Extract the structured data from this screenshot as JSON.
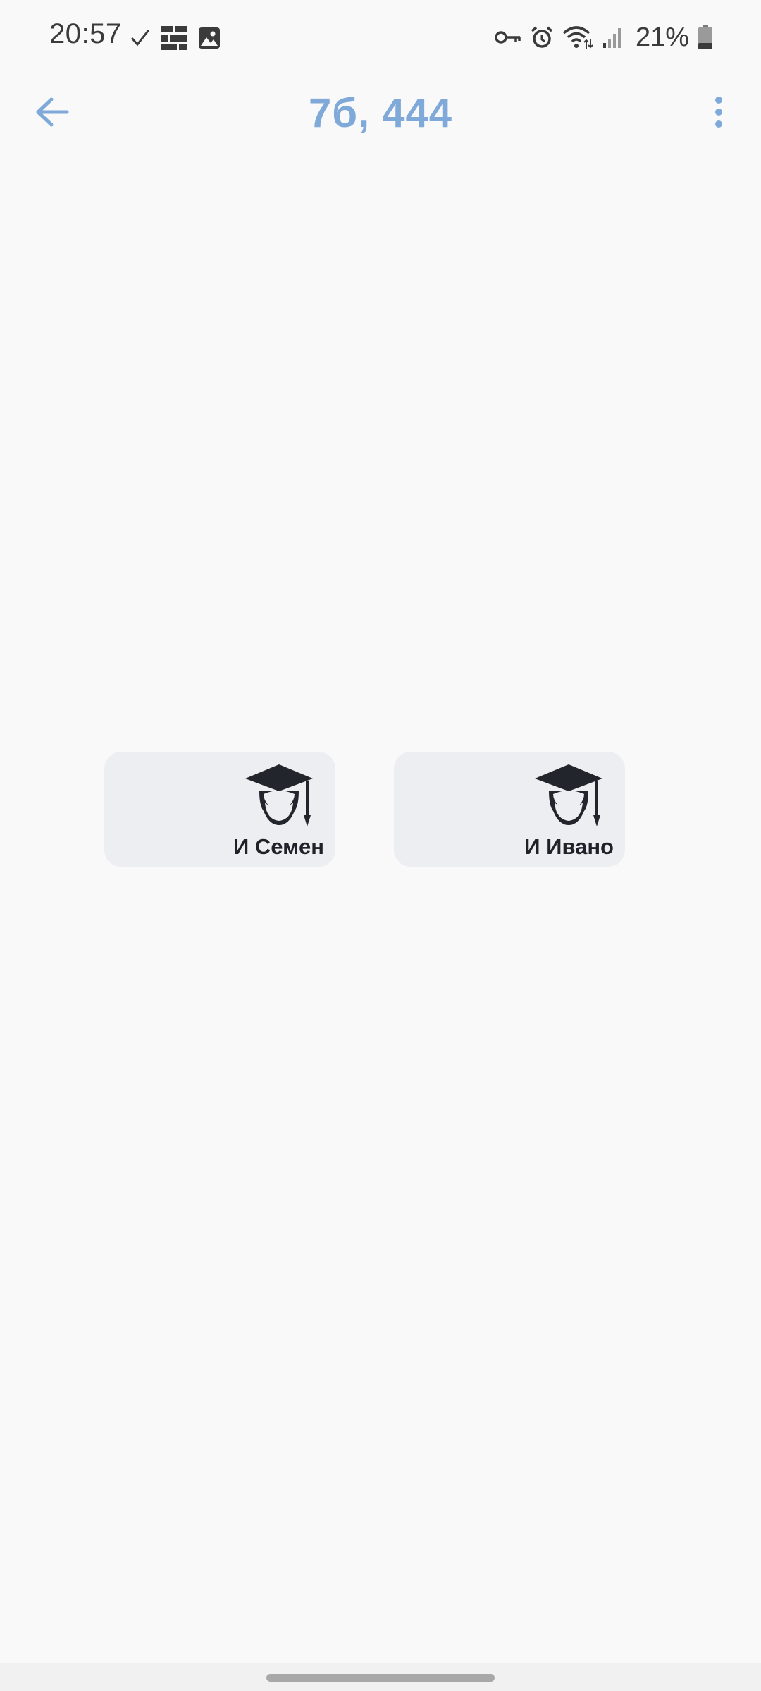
{
  "status_bar": {
    "time": "20:57",
    "battery": "21%",
    "left_icons": [
      "check-icon",
      "grid-app-icon",
      "image-icon"
    ],
    "right_icons": [
      "vpn-key-icon",
      "alarm-icon",
      "wifi-icon",
      "signal-icon",
      "battery-icon"
    ]
  },
  "app_bar": {
    "title": "7б, 444",
    "back_icon": "back-arrow-icon",
    "menu_icon": "more-vert-icon"
  },
  "students": [
    {
      "name": "И Семен",
      "icon": "student-graduation-cap-icon"
    },
    {
      "name": "И Ивано",
      "icon": "student-graduation-cap-icon"
    }
  ],
  "colors": {
    "background": "#f9f9f9",
    "accent": "#7ea9d8",
    "card_background": "#eceef1",
    "card_text": "#1f2228"
  }
}
